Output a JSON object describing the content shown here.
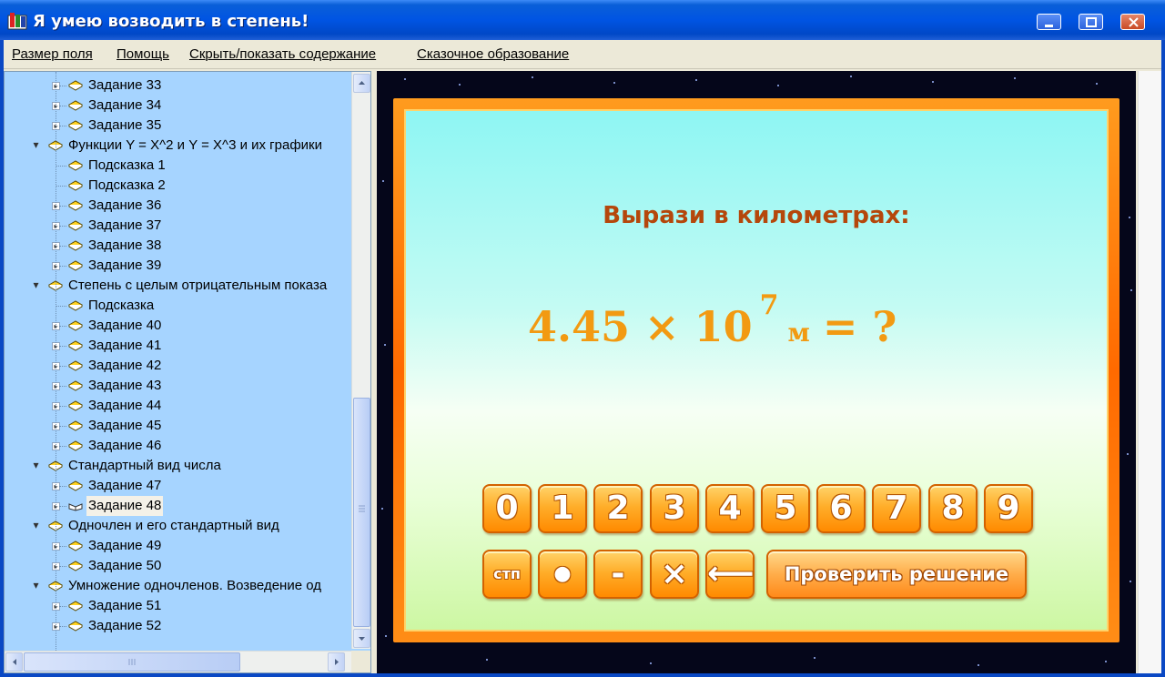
{
  "window": {
    "title": "Я умею возводить в степень!"
  },
  "menu": [
    "Размер поля",
    "Помощь",
    "Скрыть/показать содержание",
    "Сказочное образование"
  ],
  "tree": [
    {
      "label": "Задание 33",
      "level": 1,
      "expander": true
    },
    {
      "label": "Задание 34",
      "level": 1,
      "expander": true
    },
    {
      "label": "Задание 35",
      "level": 1,
      "expander": true
    },
    {
      "label": "Функции Y = X^2 и Y = X^3 и их графики",
      "level": 0,
      "expander": true,
      "expanded": true
    },
    {
      "label": "Подсказка 1",
      "level": 1,
      "expander": false
    },
    {
      "label": "Подсказка 2",
      "level": 1,
      "expander": false
    },
    {
      "label": "Задание 36",
      "level": 1,
      "expander": true
    },
    {
      "label": "Задание 37",
      "level": 1,
      "expander": true
    },
    {
      "label": "Задание 38",
      "level": 1,
      "expander": true
    },
    {
      "label": "Задание 39",
      "level": 1,
      "expander": true
    },
    {
      "label": "Степень с целым отрицательным показа",
      "level": 0,
      "expander": true,
      "expanded": true
    },
    {
      "label": "Подсказка",
      "level": 1,
      "expander": false
    },
    {
      "label": "Задание 40",
      "level": 1,
      "expander": true
    },
    {
      "label": "Задание 41",
      "level": 1,
      "expander": true
    },
    {
      "label": "Задание 42",
      "level": 1,
      "expander": true
    },
    {
      "label": "Задание 43",
      "level": 1,
      "expander": true
    },
    {
      "label": "Задание 44",
      "level": 1,
      "expander": true
    },
    {
      "label": "Задание 45",
      "level": 1,
      "expander": true
    },
    {
      "label": "Задание 46",
      "level": 1,
      "expander": true
    },
    {
      "label": "Стандартный вид числа",
      "level": 0,
      "expander": true,
      "expanded": true
    },
    {
      "label": "Задание 47",
      "level": 1,
      "expander": true
    },
    {
      "label": "Задание 48",
      "level": 1,
      "expander": true,
      "selected": true,
      "open_book": true
    },
    {
      "label": "Одночлен и его стандартный вид",
      "level": 0,
      "expander": true,
      "expanded": true
    },
    {
      "label": "Задание 49",
      "level": 1,
      "expander": true
    },
    {
      "label": "Задание 50",
      "level": 1,
      "expander": true
    },
    {
      "label": "Умножение одночленов. Возведение од",
      "level": 0,
      "expander": true,
      "expanded": true
    },
    {
      "label": "Задание 51",
      "level": 1,
      "expander": true
    },
    {
      "label": "Задание 52",
      "level": 1,
      "expander": true
    }
  ],
  "task": {
    "prompt": "Вырази в километрах:",
    "mantissa_times_base": "4.45 × 10",
    "exponent": "7",
    "unit": "м",
    "equals": "= ?"
  },
  "keypad": {
    "digits": [
      "0",
      "1",
      "2",
      "3",
      "4",
      "5",
      "6",
      "7",
      "8",
      "9"
    ],
    "ops": [
      "стп",
      "●",
      "-",
      "×",
      "⟵"
    ],
    "check_label": "Проверить решение"
  },
  "colors": {
    "title_bar": "#0054e3",
    "tree_bg": "#a6d4ff",
    "frame_orange": "#ff6a00",
    "prompt_color": "#b5470b",
    "expr_color": "#f29a12"
  }
}
